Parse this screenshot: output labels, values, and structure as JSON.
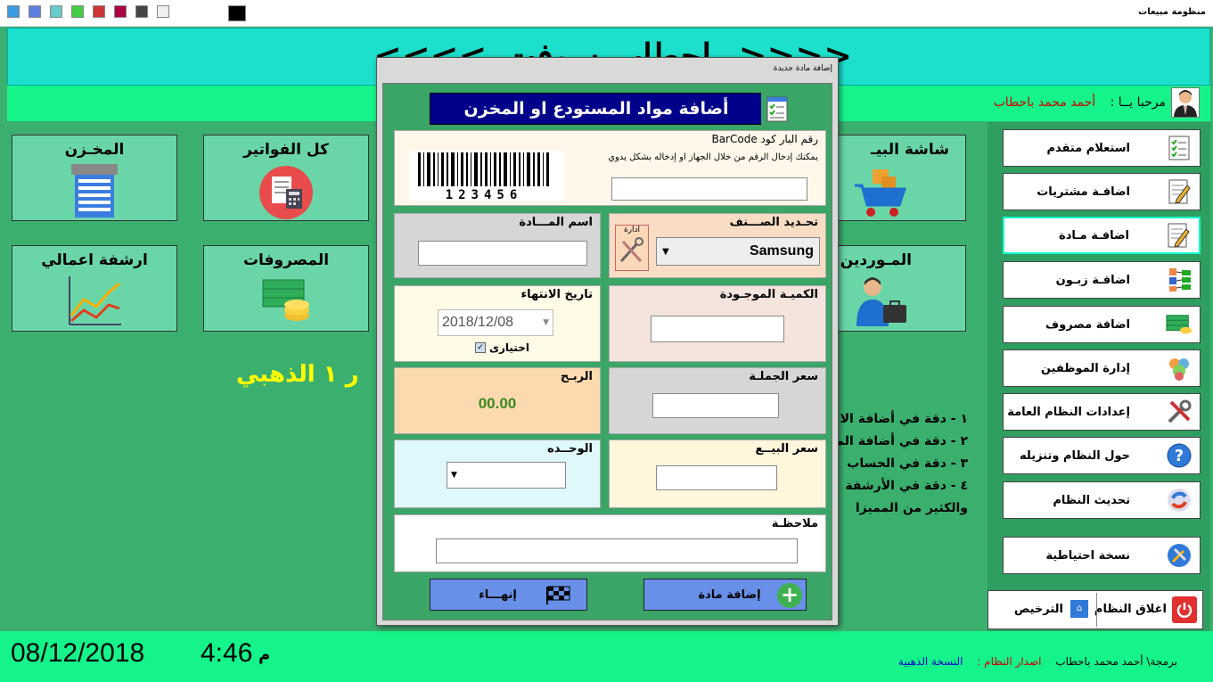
{
  "app": {
    "title": "منظومة مبيعات"
  },
  "banner": {
    "text": "<<<<_باحطاب سوفت_>>>>"
  },
  "welcome": {
    "label": "مرحبا يــا  :",
    "user": "أحمد محمد باحطاب"
  },
  "tiles": [
    {
      "label": "المخـزن",
      "icon": "warehouse-icon"
    },
    {
      "label": "كل الفواتير",
      "icon": "invoices-icon"
    },
    {
      "label": "شاشة البيـ",
      "icon": "cart-icon"
    },
    {
      "label": "ارشفة اعمالي",
      "icon": "chart-icon"
    },
    {
      "label": "المصروفات",
      "icon": "money-icon"
    },
    {
      "label": "المـوردين",
      "icon": "supplier-icon"
    }
  ],
  "gold_text": "ر ١ الذهبي",
  "features": [
    "١ - دقة في أضافة الا",
    "٢ - دقة في أضافة الم",
    "٣ - دقة في الحساب",
    "٤ - دقة في الأرشفة",
    "والكثير من المميزا"
  ],
  "sidebar": [
    {
      "label": "استعلام متقدم",
      "icon": "checklist-icon"
    },
    {
      "label": "اضافـة مشتريات",
      "icon": "edit-icon"
    },
    {
      "label": "اضافـة مـادة",
      "icon": "edit-icon"
    },
    {
      "label": "اضافـة زبـون",
      "icon": "org-icon"
    },
    {
      "label": "اضافة مصروف",
      "icon": "money-icon"
    },
    {
      "label": "إدارة الموظفين",
      "icon": "users-icon"
    },
    {
      "label": "إعدادات النظام العامة",
      "icon": "tools-icon"
    },
    {
      "label": "حول النظام وتنزيله",
      "icon": "help-icon"
    },
    {
      "label": "تحديث النظام",
      "icon": "refresh-icon"
    },
    {
      "label": "نسخة احتياطية",
      "icon": "backup-icon"
    }
  ],
  "bottom": {
    "close_label": "اغلاق النظام",
    "license_label": "الترخيص"
  },
  "status": {
    "date": "08/12/2018",
    "time": "4:46",
    "ampm": "م",
    "credit_by": "برمجة\\ أحمد محمد باحطاب",
    "version_label": "اصدار النظام :",
    "version_value": "النسخة الذهبية"
  },
  "dialog": {
    "window_title": "إضافة مادة جديدة",
    "heading": "أضافة مواد المستودع او المخزن",
    "barcode": {
      "title": "رقم البار كود BarCode",
      "hint": "يمكنك إدخال الرقم من خلال الجهاز او إدخاله بشكل يدوي",
      "sample_digits": "123456",
      "value": ""
    },
    "name": {
      "label": "اسم المـــادة",
      "value": ""
    },
    "category": {
      "label": "تحـديد الصـــنف",
      "selected": "Samsung",
      "manage_label": "ادارة"
    },
    "expiry": {
      "label": "تاريخ الانتهاء",
      "value": "2018/12/08",
      "optional_label": "اختيارى"
    },
    "quantity": {
      "label": "الكميـة الموجـودة",
      "value": ""
    },
    "profit": {
      "label": "الربـح",
      "value": "00.00"
    },
    "wholesale": {
      "label": "سعر الجملـة",
      "value": ""
    },
    "unit": {
      "label": "الوحــده",
      "value": ""
    },
    "sale_price": {
      "label": "سعر البيــع",
      "value": ""
    },
    "note": {
      "label": "ملاحظـة",
      "value": ""
    },
    "finish_button": "إنهـــاء",
    "add_button": "إضافة مادة"
  }
}
